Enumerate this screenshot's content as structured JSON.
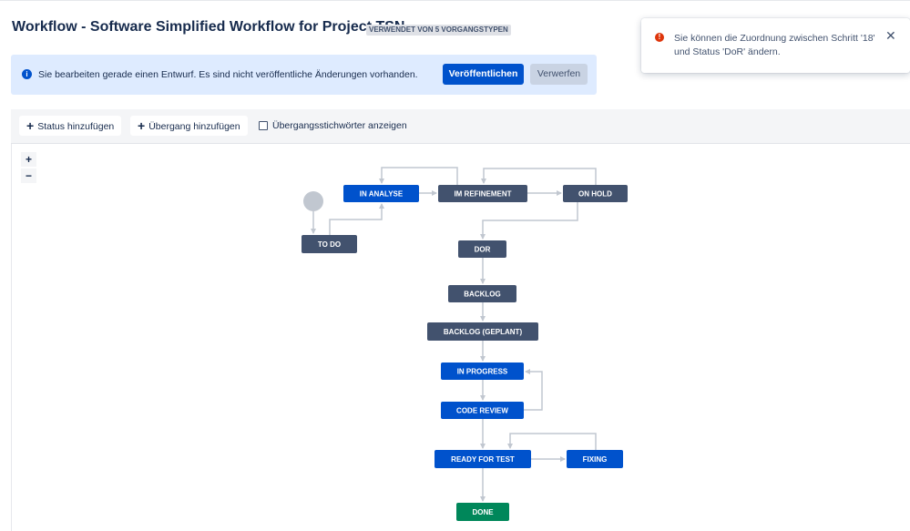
{
  "header": {
    "title": "Workflow - Software Simplified Workflow for Project TSN",
    "badge": "VERWENDET VON 5 VORGANGSTYPEN"
  },
  "banner": {
    "icon": "info-icon",
    "text": "Sie bearbeiten gerade einen Entwurf. Es sind nicht veröffentliche Änderungen vorhanden.",
    "publish_label": "Veröffentlichen",
    "discard_label": "Verwerfen"
  },
  "toast": {
    "icon": "error-icon",
    "text": "Sie können die Zuordnung zwischen Schritt '18' und Status 'DoR' ändern.",
    "close_icon": "close-icon"
  },
  "toolbar": {
    "add_status_label": "Status hinzufügen",
    "add_transition_label": "Übergang hinzufügen",
    "show_labels_checkbox_label": "Übergangsstichwörter anzeigen",
    "show_labels_checked": false
  },
  "zoom": {
    "in_label": "+",
    "out_label": "−"
  },
  "workflow": {
    "colors": {
      "todo": "#42526e",
      "in_progress": "#0052cc",
      "done": "#00875a",
      "start": "#c1c7d0",
      "edge": "#c1c7d0"
    },
    "statuses": [
      {
        "id": "todo",
        "label": "TO DO",
        "category": "todo"
      },
      {
        "id": "in_analyse",
        "label": "IN ANALYSE",
        "category": "in_progress"
      },
      {
        "id": "im_refinement",
        "label": "IM REFINEMENT",
        "category": "todo"
      },
      {
        "id": "on_hold",
        "label": "ON HOLD",
        "category": "todo"
      },
      {
        "id": "dor",
        "label": "DOR",
        "category": "todo"
      },
      {
        "id": "backlog",
        "label": "BACKLOG",
        "category": "todo"
      },
      {
        "id": "backlog_geplant",
        "label": "BACKLOG (GEPLANT)",
        "category": "todo"
      },
      {
        "id": "in_progress",
        "label": "IN PROGRESS",
        "category": "in_progress"
      },
      {
        "id": "code_review",
        "label": "CODE REVIEW",
        "category": "in_progress"
      },
      {
        "id": "ready_for_test",
        "label": "READY FOR TEST",
        "category": "in_progress"
      },
      {
        "id": "fixing",
        "label": "FIXING",
        "category": "in_progress"
      },
      {
        "id": "done",
        "label": "DONE",
        "category": "done"
      }
    ]
  }
}
